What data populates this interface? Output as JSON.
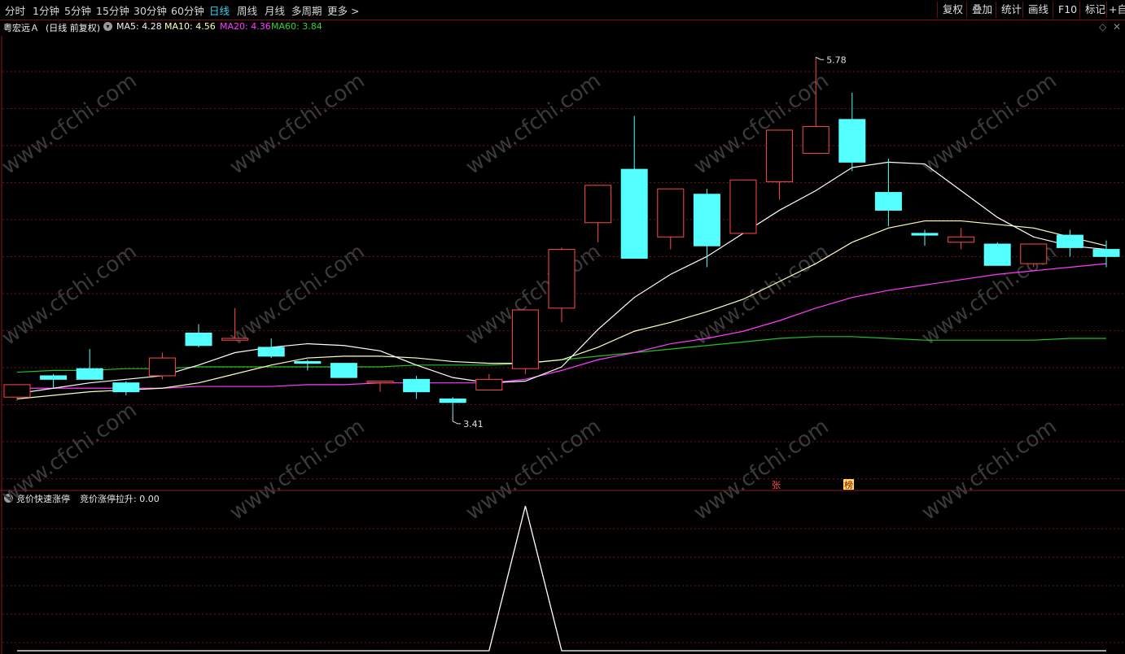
{
  "toolbar": {
    "periods": [
      "分时",
      "1分钟",
      "5分钟",
      "15分钟",
      "30分钟",
      "60分钟",
      "日线",
      "周线",
      "月线",
      "多周期",
      "更多 >"
    ],
    "active_period": "日线",
    "right_buttons": [
      "复权",
      "叠加",
      "统计",
      "画线",
      "F10",
      "标记",
      "+自"
    ]
  },
  "stock": {
    "name": "粤宏远Ａ",
    "period_label": "(日线 前复权)"
  },
  "ma_labels": {
    "ma5": "MA5: 4.28",
    "ma10": "MA10: 4.56",
    "ma20": "MA20: 4.36",
    "ma60": "MA60: 3.84"
  },
  "indicator": {
    "name": "竞价快速涨停",
    "value_label": "竞价涨停拉升: 0.00"
  },
  "annotations": {
    "high": "5.78",
    "low": "3.41",
    "marker_zhang": "张",
    "marker_bang": "榜"
  },
  "watermark": "www.cfchi.com",
  "colors": {
    "up": "#ff4a4a",
    "down": "#54ffff",
    "ma5": "#ffffff",
    "ma10": "#ffffc0",
    "ma20": "#ff3cff",
    "ma60": "#22c322",
    "grid": "#6b1313",
    "active": "#35d4f0"
  },
  "chart_data": {
    "type": "candlestick",
    "candles": [
      {
        "o": 3.87,
        "c": 3.94,
        "h": 3.94,
        "l": 3.85
      },
      {
        "o": 3.99,
        "c": 3.97,
        "h": 4.0,
        "l": 3.92
      },
      {
        "o": 4.03,
        "c": 3.97,
        "h": 4.14,
        "l": 3.97
      },
      {
        "o": 3.95,
        "c": 3.9,
        "h": 3.96,
        "l": 3.88
      },
      {
        "o": 3.99,
        "c": 4.09,
        "h": 4.12,
        "l": 3.97
      },
      {
        "o": 4.23,
        "c": 4.16,
        "h": 4.28,
        "l": 4.15
      },
      {
        "o": 4.19,
        "c": 4.2,
        "h": 4.37,
        "l": 4.19
      },
      {
        "o": 4.15,
        "c": 4.1,
        "h": 4.2,
        "l": 4.09
      },
      {
        "o": 4.07,
        "c": 4.06,
        "h": 4.08,
        "l": 4.02
      },
      {
        "o": 4.06,
        "c": 3.98,
        "h": 4.06,
        "l": 3.98
      },
      {
        "o": 3.96,
        "c": 3.96,
        "h": 3.96,
        "l": 3.9
      },
      {
        "o": 3.97,
        "c": 3.9,
        "h": 3.99,
        "l": 3.86
      },
      {
        "o": 3.86,
        "c": 3.84,
        "h": 3.87,
        "l": 3.78
      },
      {
        "o": 3.91,
        "c": 3.97,
        "h": 4.0,
        "l": 3.91
      },
      {
        "o": 4.03,
        "c": 4.36,
        "h": 4.36,
        "l": 4.0
      },
      {
        "o": 4.37,
        "c": 4.7,
        "h": 4.71,
        "l": 4.29
      },
      {
        "o": 4.85,
        "c": 5.06,
        "h": 5.06,
        "l": 4.74
      },
      {
        "o": 5.15,
        "c": 4.65,
        "h": 5.45,
        "l": 4.65
      },
      {
        "o": 4.77,
        "c": 5.04,
        "h": 5.04,
        "l": 4.7
      },
      {
        "o": 5.01,
        "c": 4.72,
        "h": 5.04,
        "l": 4.6
      },
      {
        "o": 4.79,
        "c": 5.09,
        "h": 5.09,
        "l": 4.79
      },
      {
        "o": 5.08,
        "c": 5.37,
        "h": 5.37,
        "l": 4.98
      },
      {
        "o": 5.24,
        "c": 5.39,
        "h": 5.78,
        "l": 5.24
      },
      {
        "o": 5.43,
        "c": 5.19,
        "h": 5.58,
        "l": 5.14
      },
      {
        "o": 5.02,
        "c": 4.92,
        "h": 5.21,
        "l": 4.83
      },
      {
        "o": 4.79,
        "c": 4.78,
        "h": 4.81,
        "l": 4.72
      },
      {
        "o": 4.74,
        "c": 4.77,
        "h": 4.82,
        "l": 4.7
      },
      {
        "o": 4.73,
        "c": 4.61,
        "h": 4.74,
        "l": 4.61
      },
      {
        "o": 4.62,
        "c": 4.73,
        "h": 4.73,
        "l": 4.6
      },
      {
        "o": 4.78,
        "c": 4.71,
        "h": 4.81,
        "l": 4.66
      },
      {
        "o": 4.7,
        "c": 4.66,
        "h": 4.75,
        "l": 4.6
      }
    ],
    "ma5": [
      3.89,
      3.92,
      3.95,
      3.97,
      3.99,
      4.05,
      4.12,
      4.15,
      4.17,
      4.16,
      4.13,
      4.05,
      3.98,
      3.95,
      3.96,
      4.04,
      4.25,
      4.43,
      4.56,
      4.66,
      4.79,
      4.92,
      5.03,
      5.16,
      5.19,
      5.18,
      5.03,
      4.88,
      4.77,
      4.72,
      4.7
    ],
    "ma10": [
      3.86,
      3.88,
      3.9,
      3.91,
      3.92,
      3.95,
      4.0,
      4.05,
      4.09,
      4.1,
      4.1,
      4.09,
      4.07,
      4.06,
      4.06,
      4.08,
      4.15,
      4.24,
      4.29,
      4.35,
      4.42,
      4.52,
      4.62,
      4.74,
      4.82,
      4.86,
      4.86,
      4.84,
      4.82,
      4.77,
      4.72
    ],
    "ma20": [
      3.92,
      3.92,
      3.92,
      3.92,
      3.92,
      3.93,
      3.93,
      3.93,
      3.94,
      3.94,
      3.95,
      3.95,
      3.95,
      3.95,
      3.97,
      4.02,
      4.08,
      4.12,
      4.17,
      4.2,
      4.24,
      4.3,
      4.37,
      4.43,
      4.47,
      4.5,
      4.53,
      4.56,
      4.58,
      4.6,
      4.62
    ],
    "ma60": [
      4.01,
      4.02,
      4.02,
      4.03,
      4.03,
      4.04,
      4.04,
      4.04,
      4.04,
      4.04,
      4.04,
      4.05,
      4.05,
      4.05,
      4.06,
      4.08,
      4.1,
      4.12,
      4.14,
      4.16,
      4.18,
      4.2,
      4.21,
      4.21,
      4.2,
      4.19,
      4.19,
      4.19,
      4.19,
      4.2,
      4.2
    ],
    "indicator_values": [
      0,
      0,
      0,
      0,
      0,
      0,
      0,
      0,
      0,
      0,
      0,
      0,
      0,
      0,
      1,
      0,
      0,
      0,
      0,
      0,
      0,
      0,
      0,
      0,
      0,
      0,
      0,
      0,
      0,
      0,
      0
    ],
    "ylim": [
      3.35,
      5.9
    ]
  }
}
